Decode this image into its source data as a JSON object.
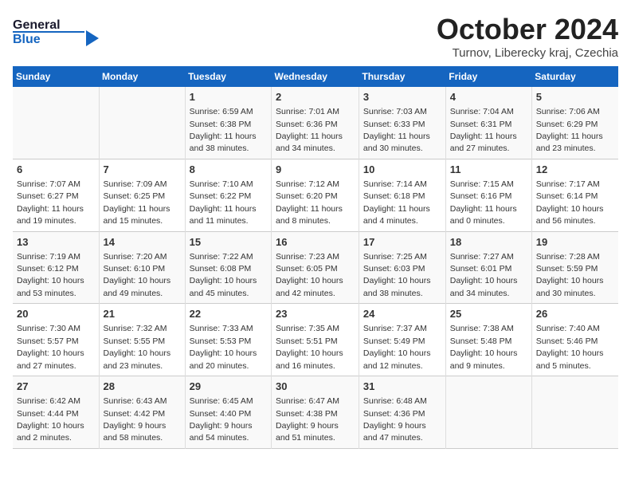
{
  "header": {
    "logo_general": "General",
    "logo_blue": "Blue",
    "month_title": "October 2024",
    "location": "Turnov, Liberecky kraj, Czechia"
  },
  "weekdays": [
    "Sunday",
    "Monday",
    "Tuesday",
    "Wednesday",
    "Thursday",
    "Friday",
    "Saturday"
  ],
  "weeks": [
    [
      {
        "day": "",
        "sunrise": "",
        "sunset": "",
        "daylight": ""
      },
      {
        "day": "",
        "sunrise": "",
        "sunset": "",
        "daylight": ""
      },
      {
        "day": "1",
        "sunrise": "Sunrise: 6:59 AM",
        "sunset": "Sunset: 6:38 PM",
        "daylight": "Daylight: 11 hours and 38 minutes."
      },
      {
        "day": "2",
        "sunrise": "Sunrise: 7:01 AM",
        "sunset": "Sunset: 6:36 PM",
        "daylight": "Daylight: 11 hours and 34 minutes."
      },
      {
        "day": "3",
        "sunrise": "Sunrise: 7:03 AM",
        "sunset": "Sunset: 6:33 PM",
        "daylight": "Daylight: 11 hours and 30 minutes."
      },
      {
        "day": "4",
        "sunrise": "Sunrise: 7:04 AM",
        "sunset": "Sunset: 6:31 PM",
        "daylight": "Daylight: 11 hours and 27 minutes."
      },
      {
        "day": "5",
        "sunrise": "Sunrise: 7:06 AM",
        "sunset": "Sunset: 6:29 PM",
        "daylight": "Daylight: 11 hours and 23 minutes."
      }
    ],
    [
      {
        "day": "6",
        "sunrise": "Sunrise: 7:07 AM",
        "sunset": "Sunset: 6:27 PM",
        "daylight": "Daylight: 11 hours and 19 minutes."
      },
      {
        "day": "7",
        "sunrise": "Sunrise: 7:09 AM",
        "sunset": "Sunset: 6:25 PM",
        "daylight": "Daylight: 11 hours and 15 minutes."
      },
      {
        "day": "8",
        "sunrise": "Sunrise: 7:10 AM",
        "sunset": "Sunset: 6:22 PM",
        "daylight": "Daylight: 11 hours and 11 minutes."
      },
      {
        "day": "9",
        "sunrise": "Sunrise: 7:12 AM",
        "sunset": "Sunset: 6:20 PM",
        "daylight": "Daylight: 11 hours and 8 minutes."
      },
      {
        "day": "10",
        "sunrise": "Sunrise: 7:14 AM",
        "sunset": "Sunset: 6:18 PM",
        "daylight": "Daylight: 11 hours and 4 minutes."
      },
      {
        "day": "11",
        "sunrise": "Sunrise: 7:15 AM",
        "sunset": "Sunset: 6:16 PM",
        "daylight": "Daylight: 11 hours and 0 minutes."
      },
      {
        "day": "12",
        "sunrise": "Sunrise: 7:17 AM",
        "sunset": "Sunset: 6:14 PM",
        "daylight": "Daylight: 10 hours and 56 minutes."
      }
    ],
    [
      {
        "day": "13",
        "sunrise": "Sunrise: 7:19 AM",
        "sunset": "Sunset: 6:12 PM",
        "daylight": "Daylight: 10 hours and 53 minutes."
      },
      {
        "day": "14",
        "sunrise": "Sunrise: 7:20 AM",
        "sunset": "Sunset: 6:10 PM",
        "daylight": "Daylight: 10 hours and 49 minutes."
      },
      {
        "day": "15",
        "sunrise": "Sunrise: 7:22 AM",
        "sunset": "Sunset: 6:08 PM",
        "daylight": "Daylight: 10 hours and 45 minutes."
      },
      {
        "day": "16",
        "sunrise": "Sunrise: 7:23 AM",
        "sunset": "Sunset: 6:05 PM",
        "daylight": "Daylight: 10 hours and 42 minutes."
      },
      {
        "day": "17",
        "sunrise": "Sunrise: 7:25 AM",
        "sunset": "Sunset: 6:03 PM",
        "daylight": "Daylight: 10 hours and 38 minutes."
      },
      {
        "day": "18",
        "sunrise": "Sunrise: 7:27 AM",
        "sunset": "Sunset: 6:01 PM",
        "daylight": "Daylight: 10 hours and 34 minutes."
      },
      {
        "day": "19",
        "sunrise": "Sunrise: 7:28 AM",
        "sunset": "Sunset: 5:59 PM",
        "daylight": "Daylight: 10 hours and 30 minutes."
      }
    ],
    [
      {
        "day": "20",
        "sunrise": "Sunrise: 7:30 AM",
        "sunset": "Sunset: 5:57 PM",
        "daylight": "Daylight: 10 hours and 27 minutes."
      },
      {
        "day": "21",
        "sunrise": "Sunrise: 7:32 AM",
        "sunset": "Sunset: 5:55 PM",
        "daylight": "Daylight: 10 hours and 23 minutes."
      },
      {
        "day": "22",
        "sunrise": "Sunrise: 7:33 AM",
        "sunset": "Sunset: 5:53 PM",
        "daylight": "Daylight: 10 hours and 20 minutes."
      },
      {
        "day": "23",
        "sunrise": "Sunrise: 7:35 AM",
        "sunset": "Sunset: 5:51 PM",
        "daylight": "Daylight: 10 hours and 16 minutes."
      },
      {
        "day": "24",
        "sunrise": "Sunrise: 7:37 AM",
        "sunset": "Sunset: 5:49 PM",
        "daylight": "Daylight: 10 hours and 12 minutes."
      },
      {
        "day": "25",
        "sunrise": "Sunrise: 7:38 AM",
        "sunset": "Sunset: 5:48 PM",
        "daylight": "Daylight: 10 hours and 9 minutes."
      },
      {
        "day": "26",
        "sunrise": "Sunrise: 7:40 AM",
        "sunset": "Sunset: 5:46 PM",
        "daylight": "Daylight: 10 hours and 5 minutes."
      }
    ],
    [
      {
        "day": "27",
        "sunrise": "Sunrise: 6:42 AM",
        "sunset": "Sunset: 4:44 PM",
        "daylight": "Daylight: 10 hours and 2 minutes."
      },
      {
        "day": "28",
        "sunrise": "Sunrise: 6:43 AM",
        "sunset": "Sunset: 4:42 PM",
        "daylight": "Daylight: 9 hours and 58 minutes."
      },
      {
        "day": "29",
        "sunrise": "Sunrise: 6:45 AM",
        "sunset": "Sunset: 4:40 PM",
        "daylight": "Daylight: 9 hours and 54 minutes."
      },
      {
        "day": "30",
        "sunrise": "Sunrise: 6:47 AM",
        "sunset": "Sunset: 4:38 PM",
        "daylight": "Daylight: 9 hours and 51 minutes."
      },
      {
        "day": "31",
        "sunrise": "Sunrise: 6:48 AM",
        "sunset": "Sunset: 4:36 PM",
        "daylight": "Daylight: 9 hours and 47 minutes."
      },
      {
        "day": "",
        "sunrise": "",
        "sunset": "",
        "daylight": ""
      },
      {
        "day": "",
        "sunrise": "",
        "sunset": "",
        "daylight": ""
      }
    ]
  ]
}
